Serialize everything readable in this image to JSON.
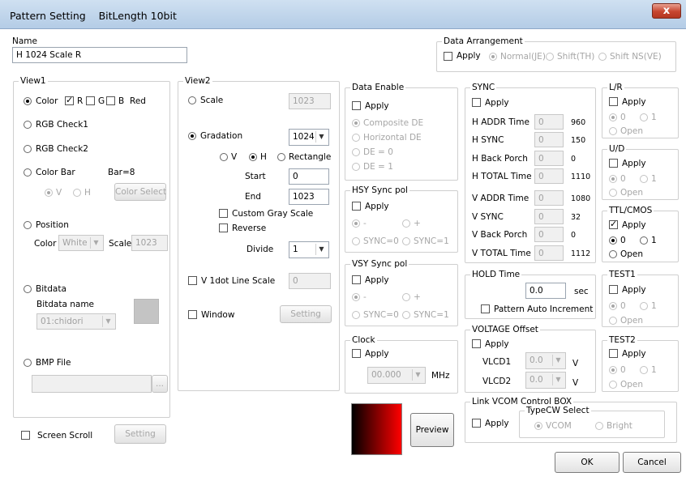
{
  "window": {
    "title": "Pattern Setting    BitLength 10bit",
    "close": "x"
  },
  "name": {
    "label": "Name",
    "value": "H 1024 Scale R"
  },
  "data_arrangement": {
    "title": "Data Arrangement",
    "apply": "Apply",
    "opt_normal": "Normal(JE)",
    "opt_shift_th": "Shift(TH)",
    "opt_shift_ns": "Shift NS(VE)"
  },
  "view1": {
    "title": "View1",
    "color": "Color",
    "r": "R",
    "g": "G",
    "b": "B",
    "color_name": "Red",
    "rgb_check1": "RGB Check1",
    "rgb_check2": "RGB Check2",
    "color_bar": "Color Bar",
    "bar": "Bar=8",
    "v": "V",
    "h": "H",
    "color_select": "Color Select",
    "position": "Position",
    "pos_color_label": "Color",
    "pos_color": "White",
    "pos_scale_label": "Scale",
    "pos_scale": "1023",
    "bitdata": "Bitdata",
    "bitdata_name": "Bitdata name",
    "bitdata_value": "01:chidori",
    "bmp_file": "BMP File",
    "browse": "..."
  },
  "view2": {
    "title": "View2",
    "scale": "Scale",
    "scale_value": "1023",
    "gradation": "Gradation",
    "gradation_value": "1024",
    "v": "V",
    "h": "H",
    "rectangle": "Rectangle",
    "start_label": "Start",
    "start": "0",
    "end_label": "End",
    "end": "1023",
    "custom_gray": "Custom Gray Scale",
    "reverse": "Reverse",
    "divide_label": "Divide",
    "divide": "1",
    "v1dot": "V 1dot Line Scale",
    "v1dot_value": "0",
    "window": "Window",
    "setting": "Setting"
  },
  "data_enable": {
    "title": "Data Enable",
    "apply": "Apply",
    "composite": "Composite DE",
    "horizontal": "Horizontal DE",
    "de0": "DE = 0",
    "de1": "DE = 1"
  },
  "hsy": {
    "title": "HSY Sync pol",
    "apply": "Apply",
    "minus": "-",
    "plus": "+",
    "sync0": "SYNC=0",
    "sync1": "SYNC=1"
  },
  "vsy": {
    "title": "VSY Sync pol",
    "apply": "Apply",
    "minus": "-",
    "plus": "+",
    "sync0": "SYNC=0",
    "sync1": "SYNC=1"
  },
  "clock": {
    "title": "Clock",
    "apply": "Apply",
    "value": "00.000",
    "unit": "MHz"
  },
  "sync": {
    "title": "SYNC",
    "apply": "Apply",
    "rows": [
      {
        "label": "H ADDR Time",
        "input": "0",
        "value": "960"
      },
      {
        "label": "H SYNC",
        "input": "0",
        "value": "150"
      },
      {
        "label": "H Back Porch",
        "input": "0",
        "value": "0"
      },
      {
        "label": "H TOTAL Time",
        "input": "0",
        "value": "1110"
      },
      {
        "label": "V ADDR Time",
        "input": "0",
        "value": "1080"
      },
      {
        "label": "V SYNC",
        "input": "0",
        "value": "32"
      },
      {
        "label": "V Back Porch",
        "input": "0",
        "value": "0"
      },
      {
        "label": "V TOTAL Time",
        "input": "0",
        "value": "1112"
      }
    ]
  },
  "hold": {
    "title": "HOLD Time",
    "value": "0.0",
    "unit": "sec",
    "auto_increment": "Pattern Auto Increment"
  },
  "voltage": {
    "title": "VOLTAGE Offset",
    "apply": "Apply",
    "vlcd1": "VLCD1",
    "vlcd1_value": "0.0",
    "vlcd2": "VLCD2",
    "vlcd2_value": "0.0",
    "unit": "V"
  },
  "lr": {
    "title": "L/R",
    "apply": "Apply",
    "opt0": "0",
    "opt1": "1",
    "open": "Open"
  },
  "ud": {
    "title": "U/D",
    "apply": "Apply",
    "opt0": "0",
    "opt1": "1",
    "open": "Open"
  },
  "ttl": {
    "title": "TTL/CMOS",
    "apply": "Apply",
    "opt0": "0",
    "opt1": "1",
    "open": "Open"
  },
  "test1": {
    "title": "TEST1",
    "apply": "Apply",
    "opt0": "0",
    "opt1": "1",
    "open": "Open"
  },
  "test2": {
    "title": "TEST2",
    "apply": "Apply",
    "opt0": "0",
    "opt1": "1",
    "open": "Open"
  },
  "link_vcom": {
    "title": "Link VCOM Control BOX",
    "apply": "Apply",
    "typecw": "TypeCW Select",
    "vcom": "VCOM",
    "bright": "Bright"
  },
  "screen_scroll": {
    "label": "Screen Scroll",
    "setting": "Setting"
  },
  "preview": {
    "label": "Preview"
  },
  "ok": "OK",
  "cancel": "Cancel",
  "colors": {
    "preview_start": "#000000",
    "preview_end": "#ff0000"
  }
}
